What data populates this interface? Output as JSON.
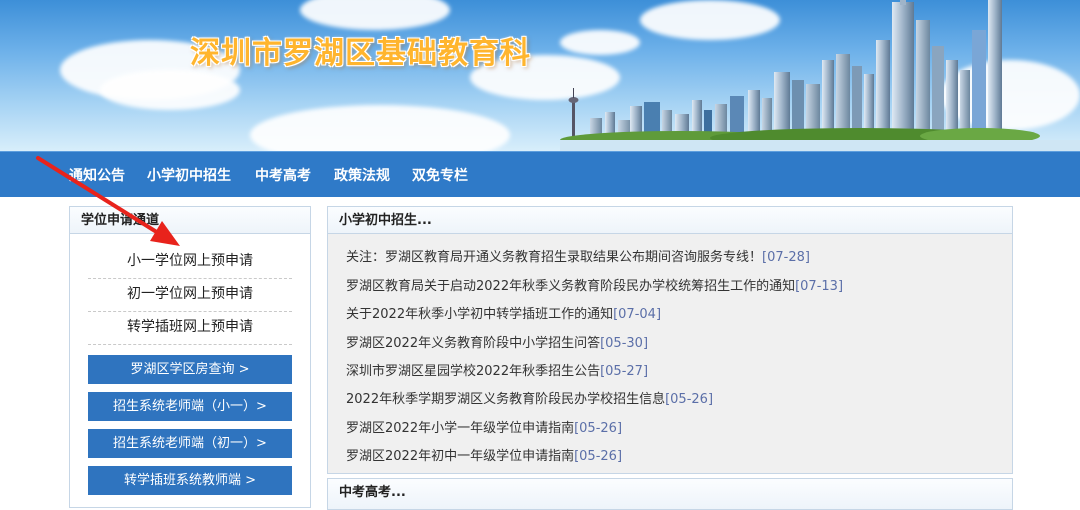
{
  "site": {
    "title": "深圳市罗湖区基础教育科"
  },
  "nav": [
    "通知公告",
    "小学初中招生",
    "中考高考",
    "政策法规",
    "双免专栏"
  ],
  "left_panel": {
    "title": "学位申请通道",
    "links": [
      "小一学位网上预申请",
      "初一学位网上预申请",
      "转学插班网上预申请"
    ],
    "buttons": [
      "罗湖区学区房查询 >",
      "招生系统老师端（小一）>",
      "招生系统老师端（初一）>",
      "转学插班系统教师端 >"
    ]
  },
  "right_panel": {
    "title": "小学初中招生...",
    "news": [
      {
        "text": "关注：罗湖区教育局开通义务教育招生录取结果公布期间咨询服务专线！",
        "date": "[07-28]"
      },
      {
        "text": "罗湖区教育局关于启动2022年秋季义务教育阶段民办学校统筹招生工作的通知",
        "date": "[07-13]"
      },
      {
        "text": "关于2022年秋季小学初中转学插班工作的通知",
        "date": "[07-04]"
      },
      {
        "text": "罗湖区2022年义务教育阶段中小学招生问答",
        "date": "[05-30]"
      },
      {
        "text": "深圳市罗湖区星园学校2022年秋季招生公告",
        "date": "[05-27]"
      },
      {
        "text": "2022年秋季学期罗湖区义务教育阶段民办学校招生信息",
        "date": "[05-26]"
      },
      {
        "text": "罗湖区2022年小学一年级学位申请指南",
        "date": "[05-26]"
      },
      {
        "text": "罗湖区2022年初中一年级学位申请指南",
        "date": "[05-26]"
      }
    ]
  },
  "right_panel2": {
    "title": "中考高考..."
  },
  "colors": {
    "nav_bg": "#2f7ac8",
    "button_bg": "#2f74bf",
    "title_orange": "#ffb52e",
    "date_color": "#5b6fa8",
    "arrow": "#e8231c"
  }
}
